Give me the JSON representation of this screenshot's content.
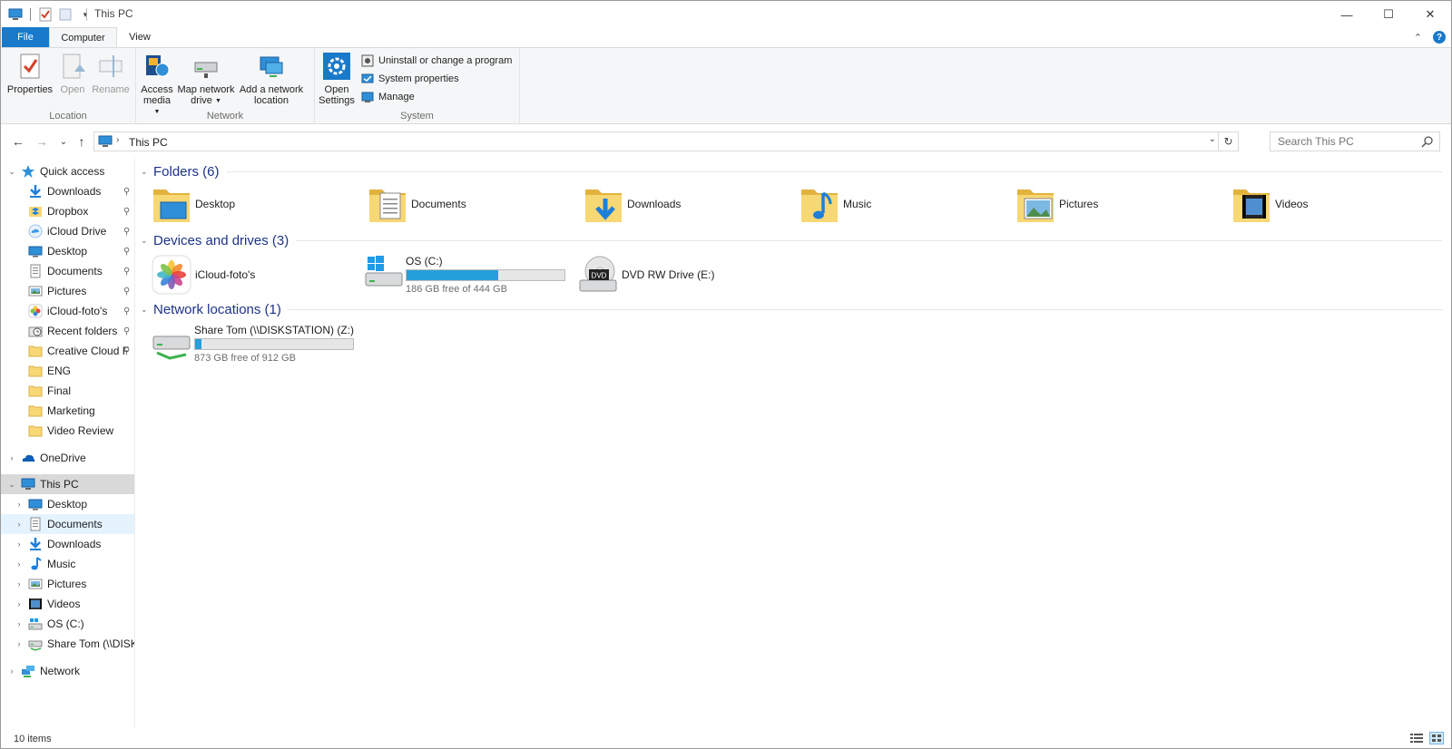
{
  "window": {
    "title": "This PC",
    "minimize_glyph": "—",
    "maximize_glyph": "☐",
    "close_glyph": "✕"
  },
  "quick_access_toolbar": {
    "icons": [
      "computer-icon",
      "properties-icon",
      "new-folder-icon",
      "customize-dropdown-icon"
    ]
  },
  "ribbon": {
    "tabs": [
      {
        "label": "File",
        "active": false
      },
      {
        "label": "Computer",
        "active": true
      },
      {
        "label": "View",
        "active": false
      }
    ],
    "help_glyph": "?",
    "collapse_glyph": "⌃",
    "groups": {
      "location": {
        "label": "Location",
        "buttons": [
          {
            "label": "Properties",
            "enabled": true
          },
          {
            "label": "Open",
            "enabled": false
          },
          {
            "label": "Rename",
            "enabled": false
          }
        ]
      },
      "network": {
        "label": "Network",
        "buttons": [
          {
            "line1": "Access",
            "line2": "media"
          },
          {
            "line1": "Map network",
            "line2": "drive"
          },
          {
            "line1": "Add a network",
            "line2": "location"
          }
        ]
      },
      "system": {
        "label": "System",
        "open_settings": {
          "line1": "Open",
          "line2": "Settings"
        },
        "small_buttons": [
          {
            "label": "Uninstall or change a program"
          },
          {
            "label": "System properties"
          },
          {
            "label": "Manage"
          }
        ]
      }
    }
  },
  "address_bar": {
    "path": "This PC",
    "separator": "›",
    "dropdown_glyph": "⌄",
    "refresh_glyph": "↻"
  },
  "search": {
    "placeholder": "Search This PC"
  },
  "nav_buttons": {
    "back": "←",
    "forward": "→",
    "recent": "⌄",
    "up": "↑"
  },
  "nav_pane": {
    "quick_access": {
      "label": "Quick access",
      "items": [
        {
          "label": "Downloads",
          "icon": "downloads-icon",
          "pinned": true
        },
        {
          "label": "Dropbox",
          "icon": "dropbox-icon",
          "pinned": true
        },
        {
          "label": "iCloud Drive",
          "icon": "icloud-drive-icon",
          "pinned": true
        },
        {
          "label": "Desktop",
          "icon": "desktop-icon",
          "pinned": true
        },
        {
          "label": "Documents",
          "icon": "documents-icon",
          "pinned": true
        },
        {
          "label": "Pictures",
          "icon": "pictures-icon",
          "pinned": true
        },
        {
          "label": "iCloud-foto's",
          "icon": "icloud-photos-icon",
          "pinned": true
        },
        {
          "label": "Recent folders",
          "icon": "recent-folders-icon",
          "pinned": true
        },
        {
          "label": "Creative Cloud F",
          "icon": "folder-icon",
          "pinned": true
        },
        {
          "label": "ENG",
          "icon": "folder-icon",
          "pinned": false
        },
        {
          "label": "Final",
          "icon": "folder-icon",
          "pinned": false
        },
        {
          "label": "Marketing",
          "icon": "folder-icon",
          "pinned": false
        },
        {
          "label": "Video Review",
          "icon": "folder-icon",
          "pinned": false
        }
      ]
    },
    "onedrive": {
      "label": "OneDrive"
    },
    "this_pc": {
      "label": "This PC",
      "items": [
        {
          "label": "Desktop",
          "icon": "desktop-icon"
        },
        {
          "label": "Documents",
          "icon": "documents-icon"
        },
        {
          "label": "Downloads",
          "icon": "downloads-icon"
        },
        {
          "label": "Music",
          "icon": "music-icon"
        },
        {
          "label": "Pictures",
          "icon": "pictures-icon"
        },
        {
          "label": "Videos",
          "icon": "videos-icon"
        },
        {
          "label": "OS (C:)",
          "icon": "os-drive-icon"
        },
        {
          "label": "Share Tom (\\\\DISKS",
          "icon": "network-drive-icon"
        }
      ]
    },
    "network": {
      "label": "Network"
    }
  },
  "content": {
    "folders": {
      "title": "Folders (6)",
      "items": [
        {
          "label": "Desktop",
          "icon": "desktop-folder-icon"
        },
        {
          "label": "Documents",
          "icon": "documents-folder-icon"
        },
        {
          "label": "Downloads",
          "icon": "downloads-folder-icon"
        },
        {
          "label": "Music",
          "icon": "music-folder-icon"
        },
        {
          "label": "Pictures",
          "icon": "pictures-folder-icon"
        },
        {
          "label": "Videos",
          "icon": "videos-folder-icon"
        }
      ]
    },
    "devices": {
      "title": "Devices and drives (3)",
      "icloud": {
        "label": "iCloud-foto's"
      },
      "os_drive": {
        "label": "OS (C:)",
        "free_text": "186 GB free of 444 GB",
        "used_fraction": 0.58
      },
      "dvd": {
        "label": "DVD RW Drive (E:)",
        "badge": "DVD"
      }
    },
    "network_locations": {
      "title": "Network locations (1)",
      "share": {
        "label": "Share Tom (\\\\DISKSTATION) (Z:)",
        "free_text": "873 GB free of 912 GB",
        "used_fraction": 0.04
      }
    }
  },
  "status_bar": {
    "item_count": "10 items"
  },
  "colors": {
    "accent": "#1979ca",
    "section_title": "#1e3287",
    "drive_fill": "#26a0da",
    "selection": "#cce8ff",
    "folder_yellow": "#f8d775"
  }
}
